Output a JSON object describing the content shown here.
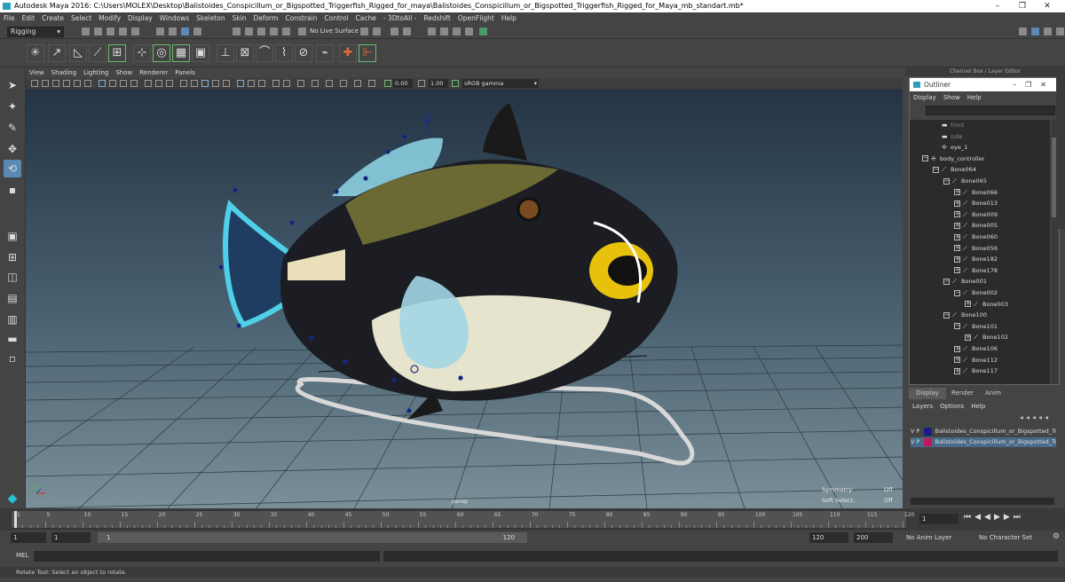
{
  "window": {
    "title": "Autodesk Maya 2016: C:\\Users\\MOLEX\\Desktop\\Balistoides_Conspicillum_or_Bigspotted_Triggerfish_Rigged_for_maya\\Balistoides_Conspicillum_or_Bigspotted_Triggerfish_Rigged_for_Maya_mb_standart.mb*",
    "controls": [
      "–",
      "❐",
      "✕"
    ]
  },
  "menubar": [
    "File",
    "Edit",
    "Create",
    "Select",
    "Modify",
    "Display",
    "Windows",
    "Skeleton",
    "Skin",
    "Deform",
    "Constrain",
    "Control",
    "Cache",
    "- 3DtoAll -",
    "Redshift",
    "OpenFlight",
    "Help"
  ],
  "statusline": {
    "menuset": "Rigging",
    "live_surface": "No Live Surface"
  },
  "channel_box_title": "Channel Box / Layer Editor",
  "viewport": {
    "menu": [
      "View",
      "Shading",
      "Lighting",
      "Show",
      "Renderer",
      "Panels"
    ],
    "exposure": "0.00",
    "gamma": "1.00",
    "color_space": "sRGB gamma",
    "camera_label": "persp",
    "hud": [
      {
        "label": "Symmetry:",
        "value": "Off"
      },
      {
        "label": "Soft Select:",
        "value": "Off"
      }
    ]
  },
  "outliner": {
    "title": "Outliner",
    "menu": [
      "Display",
      "Show",
      "Help"
    ],
    "items": [
      {
        "label": "front",
        "icon": "camera-icon",
        "level": 1,
        "expander": "",
        "dim": true
      },
      {
        "label": "side",
        "icon": "camera-icon",
        "level": 1,
        "expander": "",
        "dim": true
      },
      {
        "label": "eye_1",
        "icon": "locator-icon",
        "level": 1,
        "expander": "",
        "dim": false
      },
      {
        "label": "body_controller",
        "icon": "locator-icon",
        "level": 0,
        "expander": "−",
        "dim": false
      },
      {
        "label": "Bone064",
        "icon": "joint-icon",
        "level": 1,
        "expander": "−",
        "dim": false
      },
      {
        "label": "Bone065",
        "icon": "joint-icon",
        "level": 2,
        "expander": "−",
        "dim": false
      },
      {
        "label": "Bone066",
        "icon": "joint-icon",
        "level": 3,
        "expander": "+",
        "dim": false
      },
      {
        "label": "Bone013",
        "icon": "joint-icon",
        "level": 3,
        "expander": "+",
        "dim": false
      },
      {
        "label": "Bone009",
        "icon": "joint-icon",
        "level": 3,
        "expander": "+",
        "dim": false
      },
      {
        "label": "Bone005",
        "icon": "joint-icon",
        "level": 3,
        "expander": "+",
        "dim": false
      },
      {
        "label": "Bone060",
        "icon": "joint-icon",
        "level": 3,
        "expander": "+",
        "dim": false
      },
      {
        "label": "Bone056",
        "icon": "joint-icon",
        "level": 3,
        "expander": "+",
        "dim": false
      },
      {
        "label": "Bone182",
        "icon": "joint-icon",
        "level": 3,
        "expander": "+",
        "dim": false
      },
      {
        "label": "Bone178",
        "icon": "joint-icon",
        "level": 3,
        "expander": "+",
        "dim": false
      },
      {
        "label": "Bone001",
        "icon": "joint-icon",
        "level": 2,
        "expander": "−",
        "dim": false
      },
      {
        "label": "Bone002",
        "icon": "joint-icon",
        "level": 3,
        "expander": "−",
        "dim": false
      },
      {
        "label": "Bone003",
        "icon": "joint-icon",
        "level": 4,
        "expander": "+",
        "dim": false
      },
      {
        "label": "Bone100",
        "icon": "joint-icon",
        "level": 2,
        "expander": "−",
        "dim": false
      },
      {
        "label": "Bone101",
        "icon": "joint-icon",
        "level": 3,
        "expander": "−",
        "dim": false
      },
      {
        "label": "Bone102",
        "icon": "joint-icon",
        "level": 4,
        "expander": "+",
        "dim": false
      },
      {
        "label": "Bone106",
        "icon": "joint-icon",
        "level": 3,
        "expander": "+",
        "dim": false
      },
      {
        "label": "Bone112",
        "icon": "joint-icon",
        "level": 3,
        "expander": "+",
        "dim": false
      },
      {
        "label": "Bone117",
        "icon": "joint-icon",
        "level": 3,
        "expander": "+",
        "dim": false
      }
    ]
  },
  "layer_editor": {
    "tabs": [
      "Display",
      "Render",
      "Anim"
    ],
    "active_tab": "Display",
    "menu": [
      "Layers",
      "Options",
      "Help"
    ],
    "layers": [
      {
        "v": "V",
        "p": "P",
        "color": "#1a1a8c",
        "name": "Balistoides_Conspicillum_or_Bigspotted_Triggerfish_Rigged_for_maya_bones",
        "selected": false
      },
      {
        "v": "V",
        "p": "P",
        "color": "#c0185a",
        "name": "Balistoides_Conspicillum_or_Bigspotted_Triggerfish_Rigged_for_maya_mesh",
        "selected": true
      }
    ]
  },
  "timeline": {
    "ticks": [
      "1",
      "5",
      "10",
      "15",
      "20",
      "25",
      "30",
      "35",
      "40",
      "45",
      "50",
      "55",
      "60",
      "65",
      "70",
      "75",
      "80",
      "85",
      "90",
      "95",
      "100",
      "105",
      "110",
      "115",
      "120"
    ],
    "current_frame": "1"
  },
  "range": {
    "start": "1",
    "playback_start": "1",
    "slider_start": "1",
    "slider_end": "120",
    "playback_end": "120",
    "end": "200",
    "anim_layer": "No Anim Layer",
    "character_set": "No Character Set"
  },
  "cmdline": {
    "label": "MEL"
  },
  "helpline": "Rotate Tool: Select an object to rotate."
}
